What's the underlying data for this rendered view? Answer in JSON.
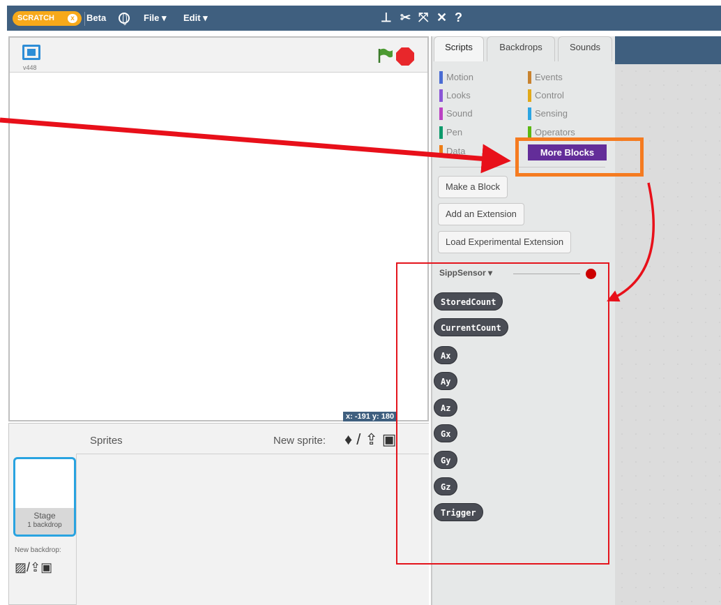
{
  "topbar": {
    "logo_text": "SCRATCH",
    "logo_x": "x",
    "beta": "Beta",
    "file_menu": "File ▾",
    "edit_menu": "Edit ▾",
    "tools": [
      "duplicate-icon",
      "cut-icon",
      "grow-icon",
      "shrink-icon",
      "help-icon"
    ]
  },
  "stage": {
    "version": "v448",
    "coords": "x: -191  y: 180"
  },
  "tabs": {
    "scripts": "Scripts",
    "backdrops": "Backdrops",
    "sounds": "Sounds"
  },
  "categories": {
    "left": [
      {
        "label": "Motion",
        "color": "#4a6cd4"
      },
      {
        "label": "Looks",
        "color": "#8a55d7"
      },
      {
        "label": "Sound",
        "color": "#bb42c3"
      },
      {
        "label": "Pen",
        "color": "#0e9a6c"
      },
      {
        "label": "Data",
        "color": "#ee7d16"
      }
    ],
    "right": [
      {
        "label": "Events",
        "color": "#c88330"
      },
      {
        "label": "Control",
        "color": "#e1a91a"
      },
      {
        "label": "Sensing",
        "color": "#2ca5e2"
      },
      {
        "label": "Operators",
        "color": "#5cb712"
      },
      {
        "label": "More Blocks",
        "color": "#632d99"
      }
    ]
  },
  "palette": {
    "make_block": "Make a Block",
    "add_extension": "Add an Extension",
    "load_experimental": "Load Experimental Extension",
    "extension_name": "SippSensor ▾",
    "reporters": [
      "StoredCount",
      "CurrentCount",
      "Ax",
      "Ay",
      "Az",
      "Gx",
      "Gy",
      "Gz",
      "Trigger"
    ]
  },
  "sprites": {
    "header": "Sprites",
    "new_sprite": "New sprite:",
    "stage_label": "Stage",
    "stage_backdrops": "1 backdrop",
    "new_backdrop": "New backdrop:"
  },
  "colors": {
    "topbar": "#3f5f7f",
    "more_blocks": "#632d99",
    "highlight_orange": "#f57b20",
    "highlight_red": "#e4141c"
  }
}
